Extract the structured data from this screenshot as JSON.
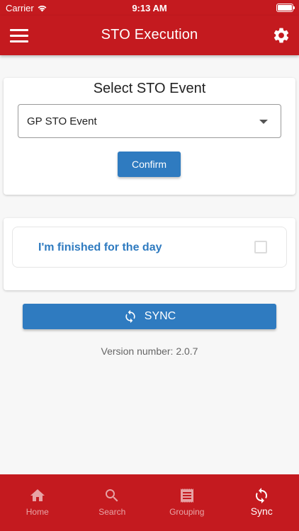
{
  "status_bar": {
    "carrier": "Carrier",
    "time": "9:13 AM"
  },
  "app_bar": {
    "title": "STO Execution"
  },
  "event_card": {
    "heading": "Select STO Event",
    "selected_event": "GP STO Event",
    "confirm_label": "Confirm"
  },
  "finished_card": {
    "label": "I'm finished for the day",
    "checked": false
  },
  "sync": {
    "label": "SYNC"
  },
  "version": {
    "text": "Version number: 2.0.7"
  },
  "bottom_nav": {
    "items": [
      {
        "label": "Home",
        "icon": "home-icon"
      },
      {
        "label": "Search",
        "icon": "search-icon"
      },
      {
        "label": "Grouping",
        "icon": "receipt-icon"
      },
      {
        "label": "Sync",
        "icon": "sync-icon",
        "active": true
      }
    ]
  },
  "colors": {
    "primary_red": "#c41a1f",
    "accent_blue": "#2f7bc0"
  }
}
